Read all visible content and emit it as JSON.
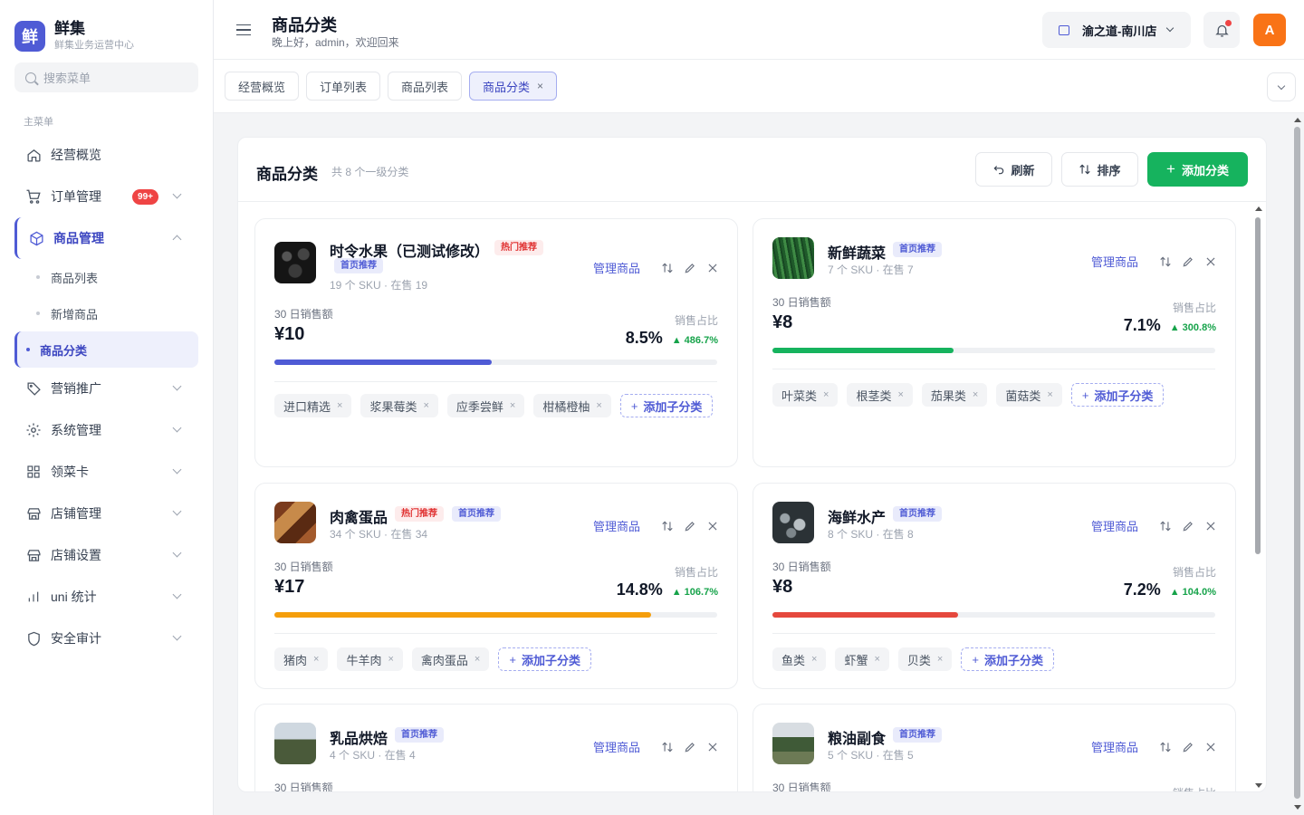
{
  "brand": {
    "logo_char": "鲜",
    "name": "鲜集",
    "subtitle": "鲜集业务运营中心",
    "color": "#4f5bd5"
  },
  "sidebar": {
    "search_placeholder": "搜索菜单",
    "section_label": "主菜单",
    "items": [
      {
        "label": "经营概览",
        "icon": "home-icon"
      },
      {
        "label": "订单管理",
        "icon": "cart-icon",
        "badge": "99+"
      },
      {
        "label": "商品管理",
        "icon": "box-icon",
        "expanded": true
      },
      {
        "label": "营销推广",
        "icon": "tag-icon"
      },
      {
        "label": "系统管理",
        "icon": "gear-icon"
      },
      {
        "label": "领菜卡",
        "icon": "grid-icon"
      },
      {
        "label": "店铺管理",
        "icon": "store-icon"
      },
      {
        "label": "店铺设置",
        "icon": "store-icon"
      },
      {
        "label": "uni 统计",
        "icon": "chart-icon"
      },
      {
        "label": "安全审计",
        "icon": "shield-icon"
      }
    ],
    "sub_items": [
      {
        "label": "商品列表"
      },
      {
        "label": "新增商品"
      },
      {
        "label": "商品分类",
        "active": true
      }
    ]
  },
  "header": {
    "title": "商品分类",
    "greeting": "晚上好，admin，欢迎回来",
    "store": "渝之道-南川店",
    "avatar_letter": "A"
  },
  "tabs": [
    {
      "label": "经营概览"
    },
    {
      "label": "订单列表"
    },
    {
      "label": "商品列表"
    },
    {
      "label": "商品分类",
      "active": true,
      "close": "×"
    }
  ],
  "panel": {
    "title": "商品分类",
    "count": "共 8 个一级分类",
    "refresh": "刷新",
    "sort": "排序",
    "add": "添加分类"
  },
  "common": {
    "manage": "管理商品",
    "sales_label": "30 日销售额",
    "share_label": "销售占比",
    "add_sub": "添加子分类",
    "tag_hot": "热门推荐",
    "tag_home": "首页推荐",
    "chip_close": "×"
  },
  "categories": [
    {
      "name": "时令水果（已测试修改）",
      "hot": true,
      "home": true,
      "sku": "19 个 SKU · 在售 19",
      "sales": "¥10",
      "share": "8.5%",
      "growth": "▲ 486.7%",
      "share_pct": 49,
      "bar_color": "#4f5bd5",
      "subs": [
        "进口精选",
        "浆果莓类",
        "应季尝鲜",
        "柑橘橙柚"
      ]
    },
    {
      "name": "新鲜蔬菜",
      "hot": false,
      "home": true,
      "sku": "7 个 SKU · 在售 7",
      "sales": "¥8",
      "share": "7.1%",
      "growth": "▲ 300.8%",
      "share_pct": 41,
      "bar_color": "#16b35e",
      "subs": [
        "叶菜类",
        "根茎类",
        "茄果类",
        "菌菇类"
      ]
    },
    {
      "name": "肉禽蛋品",
      "hot": true,
      "home": true,
      "sku": "34 个 SKU · 在售 34",
      "sales": "¥17",
      "share": "14.8%",
      "growth": "▲ 106.7%",
      "share_pct": 85,
      "bar_color": "#f59e0b",
      "subs": [
        "猪肉",
        "牛羊肉",
        "禽肉蛋品"
      ]
    },
    {
      "name": "海鲜水产",
      "hot": false,
      "home": true,
      "sku": "8 个 SKU · 在售 8",
      "sales": "¥8",
      "share": "7.2%",
      "growth": "▲ 104.0%",
      "share_pct": 42,
      "bar_color": "#e5483d",
      "subs": [
        "鱼类",
        "虾蟹",
        "贝类"
      ]
    },
    {
      "name": "乳品烘焙",
      "hot": false,
      "home": true,
      "sku": "4 个 SKU · 在售 4",
      "sales_label_only": true
    },
    {
      "name": "粮油副食",
      "hot": false,
      "home": true,
      "sku": "5 个 SKU · 在售 5",
      "sales_label_only": true
    }
  ]
}
